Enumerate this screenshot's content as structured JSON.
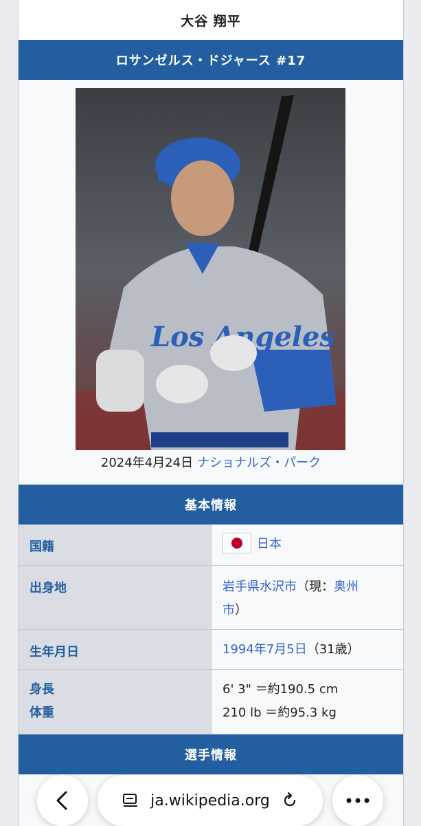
{
  "infobox": {
    "name": "大谷 翔平",
    "team": "ロサンゼルス・ドジャース #17",
    "photo_caption_date": "2024年4月24日",
    "photo_caption_link": "ナショナルズ・パーク",
    "section_basic": "基本情報",
    "rows": [
      {
        "key": "国籍",
        "value": "日本"
      },
      {
        "key": "出身地",
        "value_link": "岩手県水沢市",
        "value_text_1": "（現：",
        "value_link2_part1": "奥州",
        "value_link2_part2": "市",
        "value_text_2": "）"
      },
      {
        "key": "生年月日",
        "value_link": "1994年7月5日",
        "value_text": "（31歳）"
      },
      {
        "key1": "身長",
        "key2": "体重",
        "value1": "6' 3\" ＝約190.5 cm",
        "value2": "210 lb ＝約95.3 kg"
      }
    ],
    "section_player": "選手情報"
  },
  "browser": {
    "url": "ja.wikipedia.org"
  },
  "colors": {
    "header_blue": "#235fa0",
    "link_blue": "#3366cc",
    "label_bg": "#dadde3"
  }
}
